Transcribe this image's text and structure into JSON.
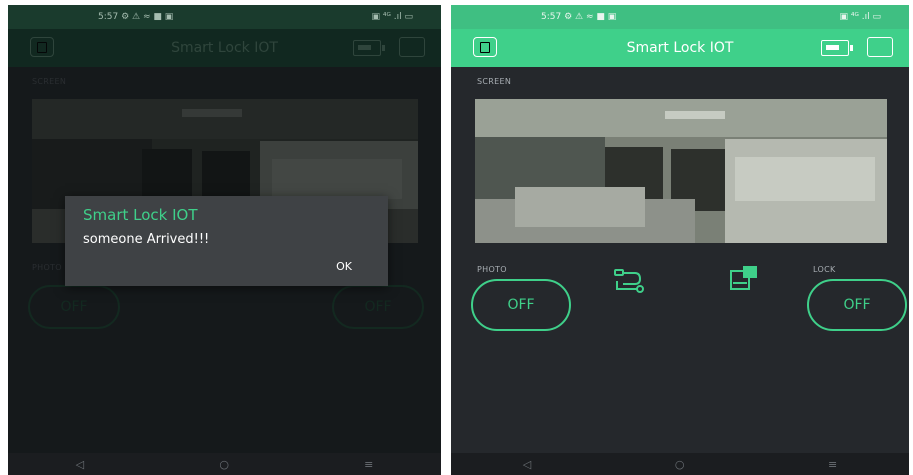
{
  "status_bar": {
    "time": "5:57",
    "icons_left": "⚙ ⚠ ≈ ■ ▣",
    "icons_right": "▣ ⁴ᴳ .ıl ▭"
  },
  "app": {
    "title": "Smart Lock IOT"
  },
  "labels": {
    "screen": "SCREEN",
    "photo": "PHOTO",
    "lock": "LOCK"
  },
  "buttons": {
    "photo": "OFF",
    "lock": "OFF"
  },
  "dialog": {
    "title": "Smart Lock IOT",
    "message": "someone Arrived!!!",
    "ok": "OK"
  },
  "nav": {
    "back": "◁",
    "home": "○",
    "recents": "≡"
  },
  "colors": {
    "accent": "#3fd08a",
    "background": "#25282c"
  }
}
